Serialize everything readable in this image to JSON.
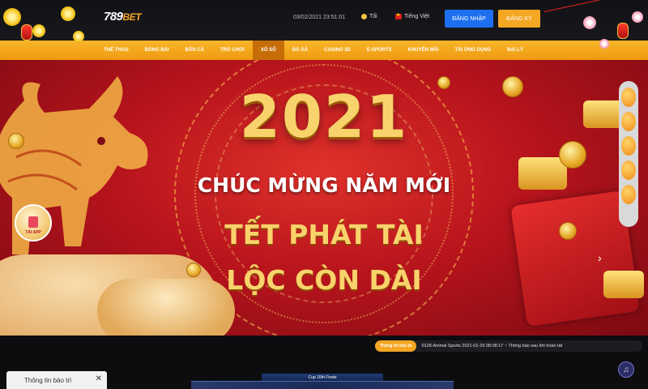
{
  "header": {
    "logo_num": "789",
    "logo_bet": "BET",
    "datetime": "03/02/2021 23:51:01",
    "theme_label": "Tối",
    "language_label": "Tiếng Việt",
    "login_label": "ĐĂNG NHẬP",
    "register_label": "ĐĂNG KÝ"
  },
  "nav": {
    "items": [
      {
        "label": "THỂ THAO"
      },
      {
        "label": "BÓNG BÀI"
      },
      {
        "label": "BẮN CÁ"
      },
      {
        "label": "TRÒ CHƠI"
      },
      {
        "label": "XỔ SỐ"
      },
      {
        "label": "ĐÁ GÀ"
      },
      {
        "label": "CASINO 3D"
      },
      {
        "label": "E-SPORTS"
      },
      {
        "label": "KHUYẾN MÃI"
      },
      {
        "label": "TẢI ỨNG DỤNG"
      },
      {
        "label": "ĐẠI LÝ"
      }
    ],
    "active_index": 4
  },
  "banner": {
    "year": "2021",
    "line1": "CHÚC MỪNG NĂM MỚI",
    "line2": "TẾT PHÁT TÀI",
    "line3": "LỘC CÒN DÀI",
    "tai_app_label": "TẢI APP",
    "next_icon": "chevron-right-icon"
  },
  "side_rail": {
    "buttons": [
      {
        "label": "",
        "icon": "user-support-icon"
      },
      {
        "label": "",
        "icon": "gift-icon"
      },
      {
        "label": "",
        "icon": "chat-icon"
      },
      {
        "label": "",
        "icon": "phone-icon"
      },
      {
        "label": "",
        "icon": "mail-icon"
      }
    ]
  },
  "ticker": {
    "badge": "Thông tin bảo trì",
    "text": "0128-Animal Sports 2021-01-29 08:08:17 ~ Thông báo sau khi hoàn tất"
  },
  "cup": {
    "header": "Cup 16th Finals"
  },
  "maintenance_panel": {
    "title": "Thông tin bảo trì",
    "close_glyph": "✕"
  },
  "music_glyph": "♫",
  "colors": {
    "accent_orange": "#f5a623",
    "login_blue": "#1d6ff0",
    "banner_red": "#b8141c",
    "gold": "#f8d36b"
  }
}
